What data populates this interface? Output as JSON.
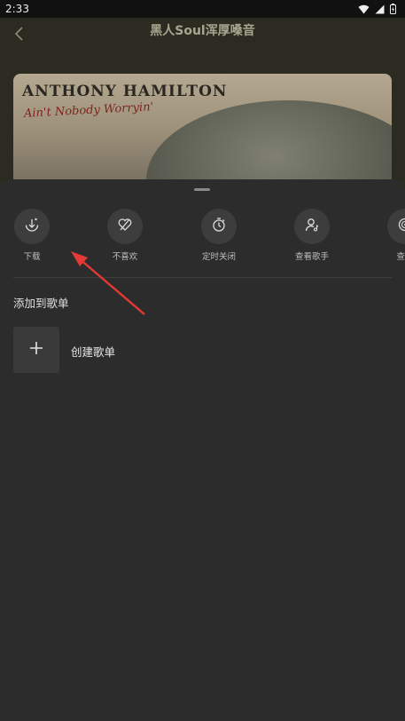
{
  "status_bar": {
    "time": "2:33",
    "icons": [
      "wifi-icon",
      "signal-icon",
      "battery-icon"
    ]
  },
  "header": {
    "title": "黑人Soul浑厚嗓音",
    "back_icon": "chevron-left-icon"
  },
  "album_art": {
    "artist": "ANTHONY HAMILTON",
    "subtitle": "Ain't Nobody Worryin'"
  },
  "sheet": {
    "actions": [
      {
        "label": "下载",
        "icon": "download-icon"
      },
      {
        "label": "不喜欢",
        "icon": "dislike-heart-icon"
      },
      {
        "label": "定时关闭",
        "icon": "timer-icon"
      },
      {
        "label": "查看歌手",
        "icon": "singer-icon"
      },
      {
        "label": "查看",
        "icon": "album-icon"
      }
    ],
    "section_title": "添加到歌单",
    "create_playlist_label": "创建歌单"
  },
  "colors": {
    "sheet_bg": "#2c2c2c",
    "header_bg": "#2b2b22",
    "arrow": "#e53935"
  }
}
